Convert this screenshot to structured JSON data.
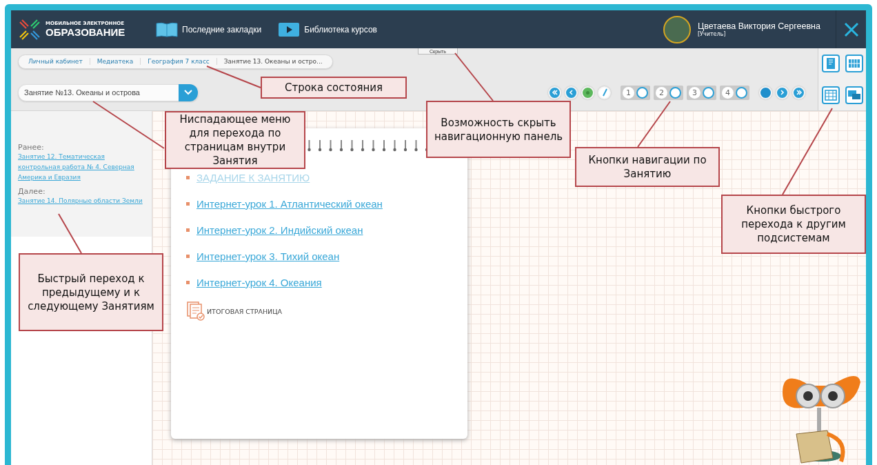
{
  "header": {
    "logo": {
      "line1": "МОБИЛЬНОЕ ЭЛЕКТРОННОЕ",
      "line2": "ОБРАЗОВАНИЕ"
    },
    "nav": [
      {
        "kind": "bookmarks",
        "label": "Последние закладки"
      },
      {
        "kind": "library",
        "label": "Библиотека курсов"
      }
    ],
    "user": {
      "name": "Цветаева Виктория Сергеевна",
      "role": "[Учитель]"
    }
  },
  "toolbar": {
    "hide_button": "Скрыть",
    "breadcrumbs": [
      "Личный кабинет",
      "Медиатека",
      "География 7 класс",
      "Занятие 13. Океаны и остро..."
    ],
    "lesson_select": "Занятие №13. Океаны и острова",
    "nav_before": [
      {
        "kind": "first",
        "selected": false
      },
      {
        "kind": "prev",
        "selected": false
      },
      {
        "kind": "current",
        "selected": true
      },
      {
        "kind": "edit",
        "selected": false
      }
    ],
    "pages": [
      {
        "label": "1"
      },
      {
        "label": "2"
      },
      {
        "label": "3"
      },
      {
        "label": "4"
      }
    ],
    "nav_after": [
      {
        "kind": "dot",
        "selected": false
      },
      {
        "kind": "next",
        "selected": false
      },
      {
        "kind": "last",
        "selected": false
      }
    ],
    "subsystems": [
      {
        "kind": "journal"
      },
      {
        "kind": "schedule"
      },
      {
        "kind": "calendar"
      },
      {
        "kind": "messages"
      }
    ]
  },
  "sidebar": {
    "earlier_label": "Ранее:",
    "earlier_link": "Занятие 12. Тематическая контрольная работа № 4. Северная Америка и Евразия",
    "later_label": "Далее:",
    "later_link": "Занятие 14. Полярные области Земли"
  },
  "content": {
    "items": [
      {
        "kind": "task",
        "label": "ЗАДАНИЕ К ЗАНЯТИЮ"
      },
      {
        "kind": "lesson",
        "label": "Интернет-урок 1. Атлантический океан"
      },
      {
        "kind": "lesson",
        "label": "Интернет-урок 2. Индийский океан"
      },
      {
        "kind": "lesson",
        "label": "Интернет-урок 3. Тихий океан"
      },
      {
        "kind": "lesson",
        "label": "Интернет-урок 4. Океания"
      }
    ],
    "summary": "ИТОГОВАЯ СТРАНИЦА"
  },
  "annotations": [
    {
      "text": "Строка состояния"
    },
    {
      "text": "Ниспадающее меню для перехода по страницам внутри Занятия"
    },
    {
      "text": "Возможность скрыть навигационную панель"
    },
    {
      "text": "Кнопки навигации по Занятию"
    },
    {
      "text": "Кнопки быстрого перехода к другим подсистемам"
    },
    {
      "text": "Быстрый переход к предыдущему и к следующему Занятиям"
    }
  ]
}
